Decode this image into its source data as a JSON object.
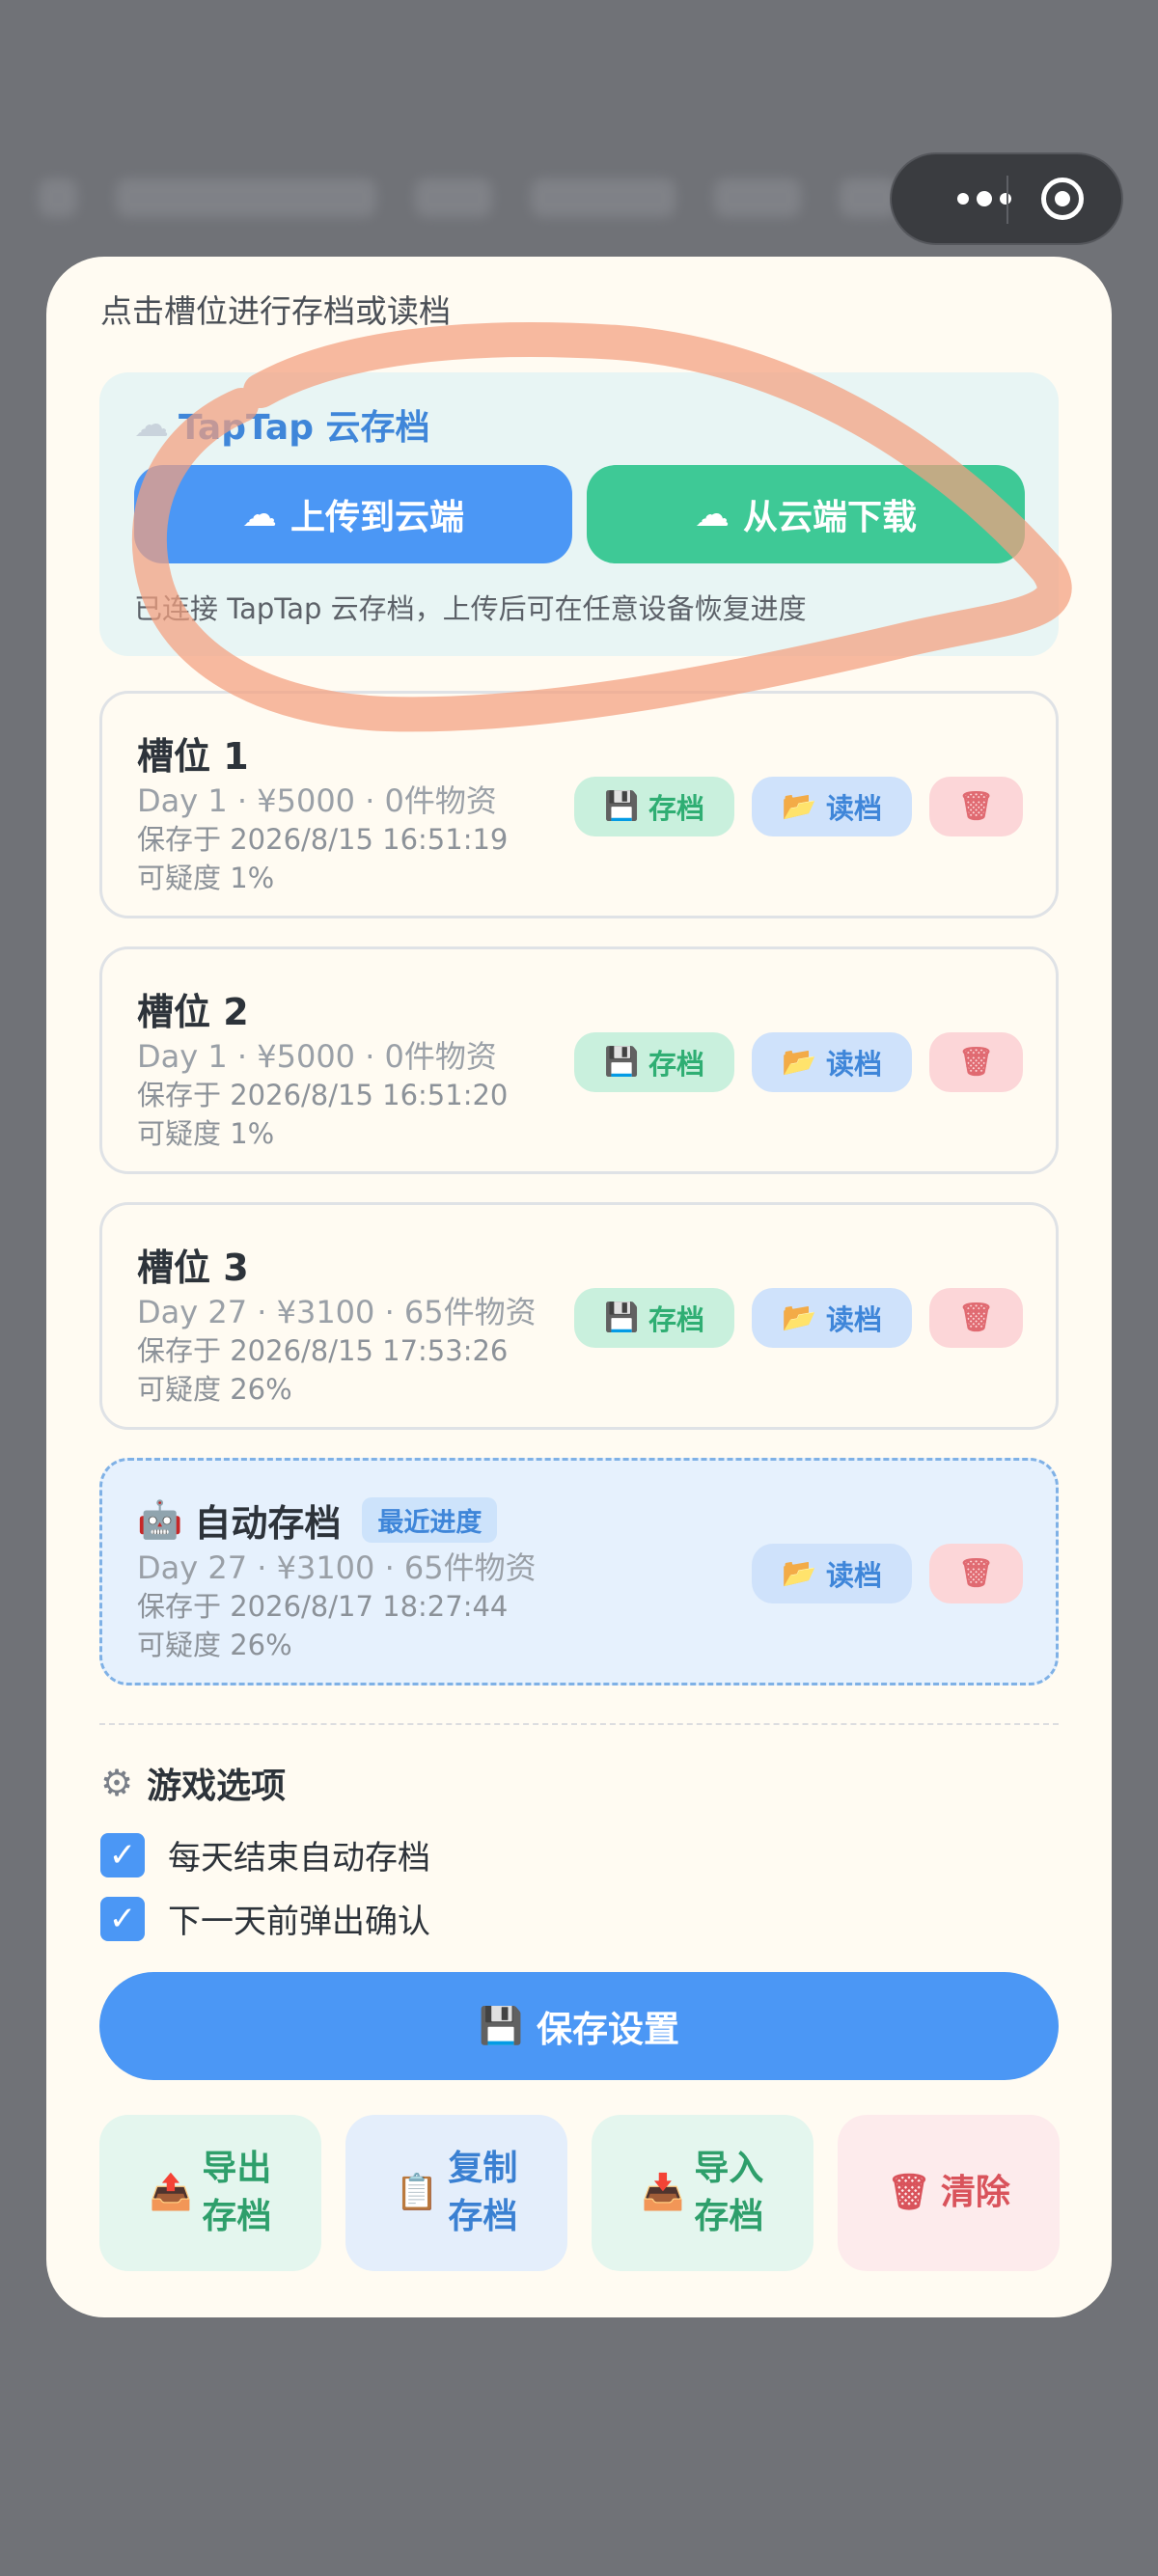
{
  "hint": "点击槽位进行存档或读档",
  "cloud": {
    "title": "TapTap 云存档",
    "title_icon": "cloud-icon",
    "upload_label": "上传到云端",
    "download_label": "从云端下载",
    "note": "已连接 TapTap 云存档，上传后可在任意设备恢复进度"
  },
  "slots": [
    {
      "title": "槽位 1",
      "line1": "Day 1 · ¥5000 · 0件物资",
      "line2": "保存于 2026/8/15 16:51:19",
      "line3": "可疑度 1%"
    },
    {
      "title": "槽位 2",
      "line1": "Day 1 · ¥5000 · 0件物资",
      "line2": "保存于 2026/8/15 16:51:20",
      "line3": "可疑度 1%"
    },
    {
      "title": "槽位 3",
      "line1": "Day 27 · ¥3100 · 65件物资",
      "line2": "保存于 2026/8/15 17:53:26",
      "line3": "可疑度 26%"
    }
  ],
  "auto_slot": {
    "icon": "robot-icon",
    "title": "自动存档",
    "badge": "最近进度",
    "line1": "Day 27 · ¥3100 · 65件物资",
    "line2": "保存于 2026/8/17 18:27:44",
    "line3": "可疑度 26%"
  },
  "slot_buttons": {
    "save": "存档",
    "load": "读档"
  },
  "options": {
    "title": "游戏选项",
    "items": [
      {
        "label": "每天结束自动存档",
        "checked": true
      },
      {
        "label": "下一天前弹出确认",
        "checked": true
      }
    ],
    "save_label": "保存设置"
  },
  "tiles": {
    "export": [
      "导出",
      "存档"
    ],
    "copy": [
      "复制",
      "存档"
    ],
    "import": [
      "导入",
      "存档"
    ],
    "clear": "清除"
  },
  "colors": {
    "accent_blue": "#4b97f5",
    "accent_green": "#3ec996",
    "danger": "#d9535b",
    "annotation_stroke": "#f4a07e"
  }
}
